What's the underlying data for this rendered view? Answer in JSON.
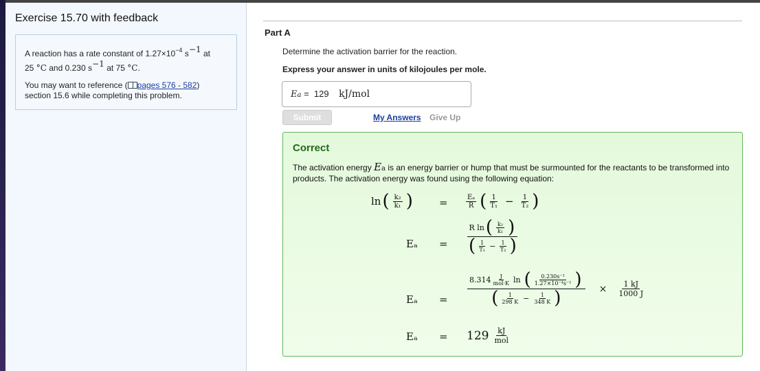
{
  "left": {
    "title": "Exercise 15.70 with feedback",
    "question": {
      "p1a": "A reaction has a rate constant of 1.27×10",
      "exp1": "−4",
      "unit1": "s",
      "exp2": "−1",
      "p1b": "at",
      "p2a": "25",
      "deg": "°C",
      "p2b": "and 0.230",
      "unit2": "s",
      "exp3": "−1",
      "p2c": "at 75",
      "deg2": "°C",
      "dot": "."
    },
    "reference": {
      "pre": "You may want to reference (",
      "link": "pages 576 - 582",
      "post": ")",
      "line2": "section 15.6 while completing this problem."
    }
  },
  "part": {
    "label": "Part A",
    "prompt": "Determine the activation barrier for the reaction.",
    "instruction": "Express your answer in units of kilojoules per mole.",
    "answer": {
      "var": "E",
      "sub": "a",
      "eq": "=",
      "value": "129",
      "unit": "kJ/mol"
    },
    "submit": "Submit",
    "my_answers": "My Answers",
    "give_up": "Give Up"
  },
  "feedback": {
    "title": "Correct",
    "text_a": "The activation energy",
    "var": "E",
    "sub": "a",
    "text_b": "is an energy barrier or hump that must be surmounted for the reactants to be transformed into products. The activation energy was found using the following equation:",
    "eq1": {
      "ln": "ln",
      "k2": "k₂",
      "k1": "k₁",
      "eq": "=",
      "ea": "Eₐ",
      "r": "R",
      "one": "1",
      "t1": "T₁",
      "minus": "−",
      "t2": "T₂"
    },
    "eq2": {
      "lhs": "Eₐ",
      "eq": "=",
      "rln": "R ln",
      "k2": "k₂",
      "k1": "k₁",
      "one": "1",
      "t1": "T₁",
      "minus": "−",
      "t2": "T₂"
    },
    "eq3": {
      "lhs": "Eₐ",
      "eq": "=",
      "r": "8.314",
      "j": "J",
      "molk": "mol·K",
      "ln": "ln",
      "num": "0.230s⁻¹",
      "den": "1.27×10⁻⁴s⁻¹",
      "one": "1",
      "t1": "298  K",
      "minus": "−",
      "t2": "348  K",
      "times": "×",
      "kj": "1 kJ",
      "j1000": "1000 J"
    },
    "eq4": {
      "lhs": "Eₐ",
      "eq": "=",
      "val": "129",
      "kj": "kJ",
      "mol": "mol"
    }
  }
}
